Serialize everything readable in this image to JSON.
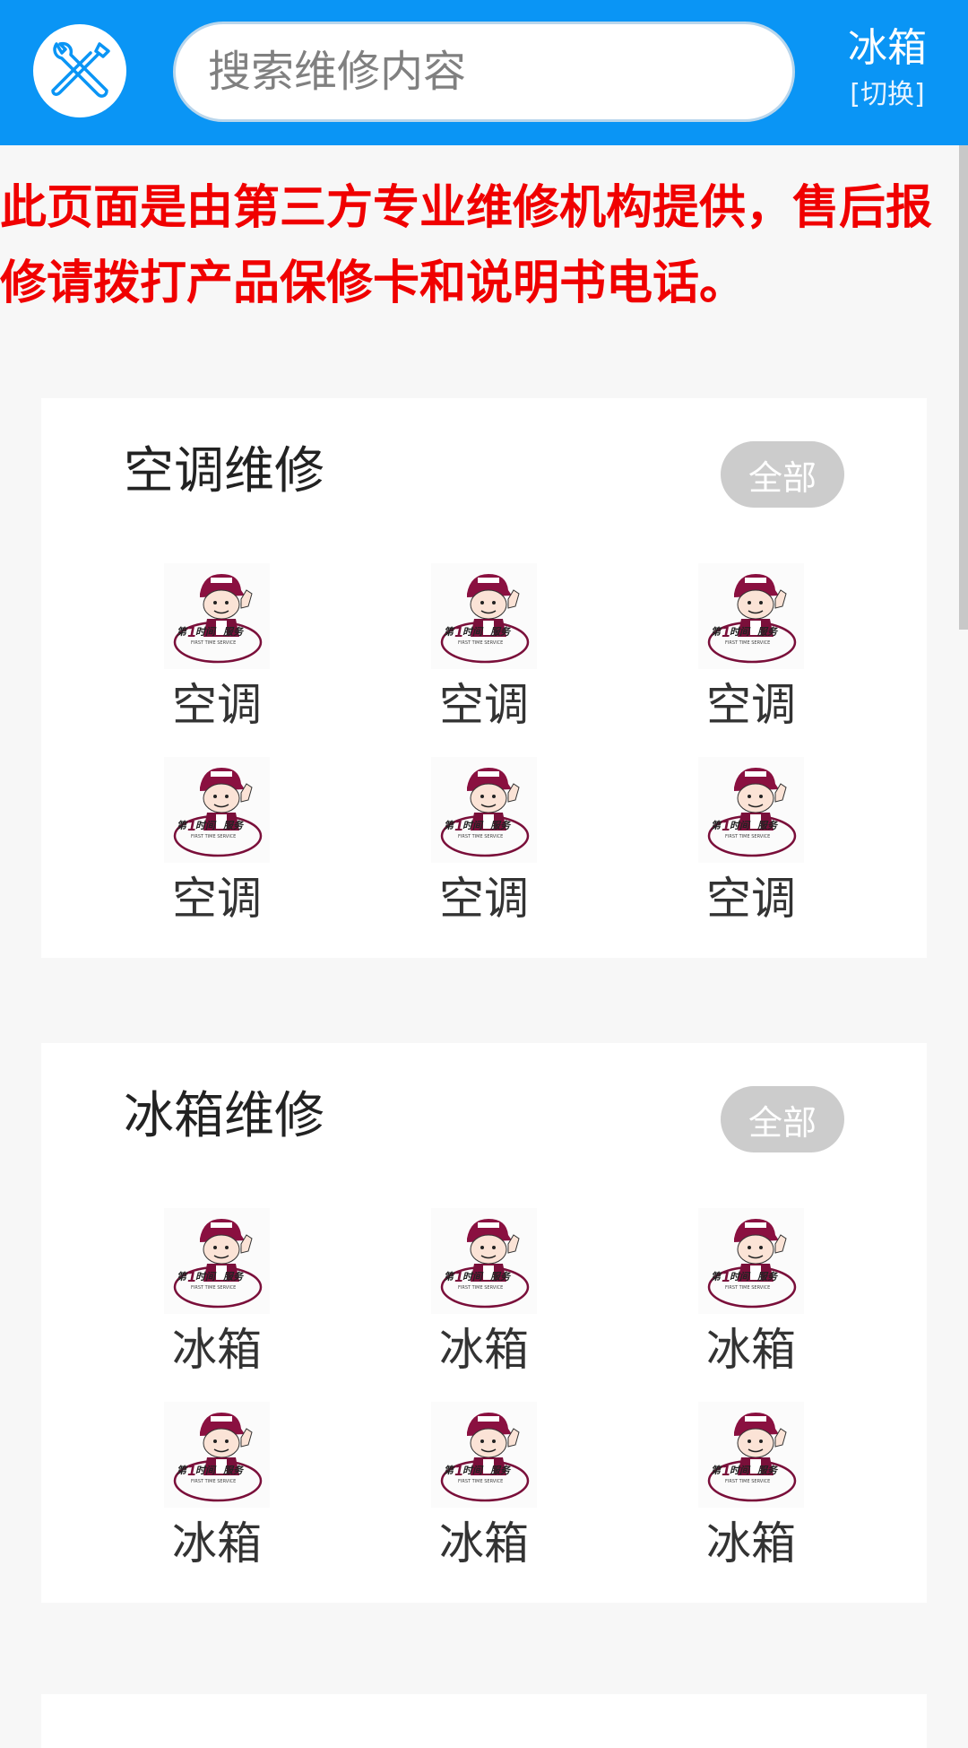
{
  "header": {
    "search_placeholder": "搜索维修内容",
    "city": "冰箱",
    "switch_label": "[切换]",
    "background_color": "#0a95f5",
    "logo_icon": "wrench-screwdriver-icon"
  },
  "notice": {
    "line1": "此页面是由第三方专业维修机构提供，售后报",
    "line2": "修请拨打产品保修卡和说明书电话。",
    "color": "#f00000"
  },
  "sections": [
    {
      "title": "空调维修",
      "all_label": "全部",
      "items": [
        {
          "label": "空调"
        },
        {
          "label": "空调"
        },
        {
          "label": "空调"
        },
        {
          "label": "空调"
        },
        {
          "label": "空调"
        },
        {
          "label": "空调"
        }
      ]
    },
    {
      "title": "冰箱维修",
      "all_label": "全部",
      "items": [
        {
          "label": "冰箱"
        },
        {
          "label": "冰箱"
        },
        {
          "label": "冰箱"
        },
        {
          "label": "冰箱"
        },
        {
          "label": "冰箱"
        },
        {
          "label": "冰箱"
        }
      ]
    }
  ],
  "service_logo": {
    "icon": "repairman-logo",
    "text": "第1时间 服务",
    "subtext": "FIRST TIME SERVICE"
  }
}
